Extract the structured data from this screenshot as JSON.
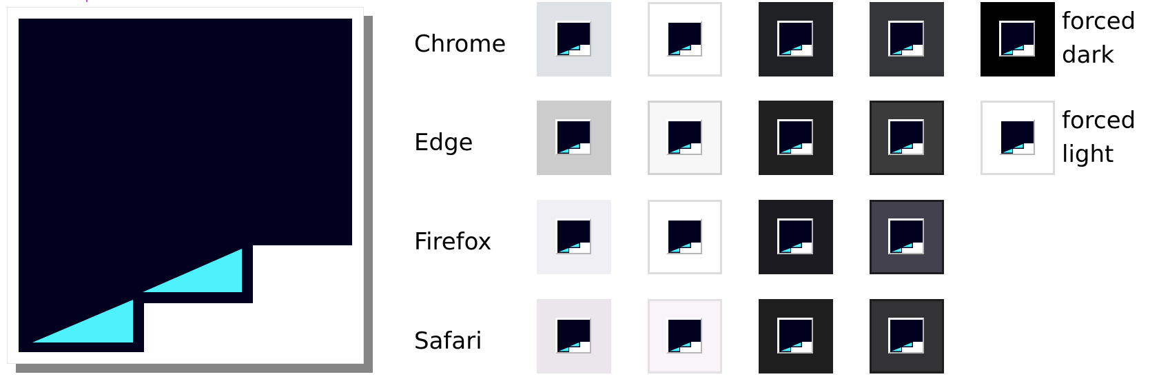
{
  "rows": [
    {
      "label": "Chrome",
      "tiles": [
        {
          "bg": "#dee1e6",
          "border": "#dee1e6"
        },
        {
          "bg": "#ffffff",
          "border": "#dedede"
        },
        {
          "bg": "#202124",
          "border": "#202124"
        },
        {
          "bg": "#35363a",
          "border": "#35363a"
        },
        {
          "bg": "#000000",
          "border": "#000000"
        }
      ],
      "side_label": [
        "forced",
        "dark"
      ]
    },
    {
      "label": "Edge",
      "tiles": [
        {
          "bg": "#cccccc",
          "border": "#cccccc"
        },
        {
          "bg": "#f7f7f7",
          "border": "#d2d2d2"
        },
        {
          "bg": "#202020",
          "border": "#202020"
        },
        {
          "bg": "#3b3b3b",
          "border": "#1c1c1c"
        },
        {
          "bg": "#ffffff",
          "border": "#dcdcdc"
        }
      ],
      "side_label": [
        "forced",
        "light"
      ]
    },
    {
      "label": "Firefox",
      "tiles": [
        {
          "bg": "#f0f0f4",
          "border": "#f0f0f4"
        },
        {
          "bg": "#ffffff",
          "border": "#dcdcdc"
        },
        {
          "bg": "#1c1b22",
          "border": "#1c1b22"
        },
        {
          "bg": "#42414d",
          "border": "#1c1b22"
        }
      ],
      "side_label": []
    },
    {
      "label": "Safari",
      "tiles": [
        {
          "bg": "#eae6eb",
          "border": "#eae6eb"
        },
        {
          "bg": "#f8f4f8",
          "border": "#e4e0e4"
        },
        {
          "bg": "#1e1e1e",
          "border": "#1e1e1e"
        },
        {
          "bg": "#333336",
          "border": "#1e1e1e"
        }
      ],
      "side_label": []
    }
  ],
  "icon_colors": {
    "navy": "#01001e",
    "cyan": "#4ef2fc",
    "paper": "#ffffff",
    "shadow": "#858585",
    "accent": "#d946ef"
  }
}
